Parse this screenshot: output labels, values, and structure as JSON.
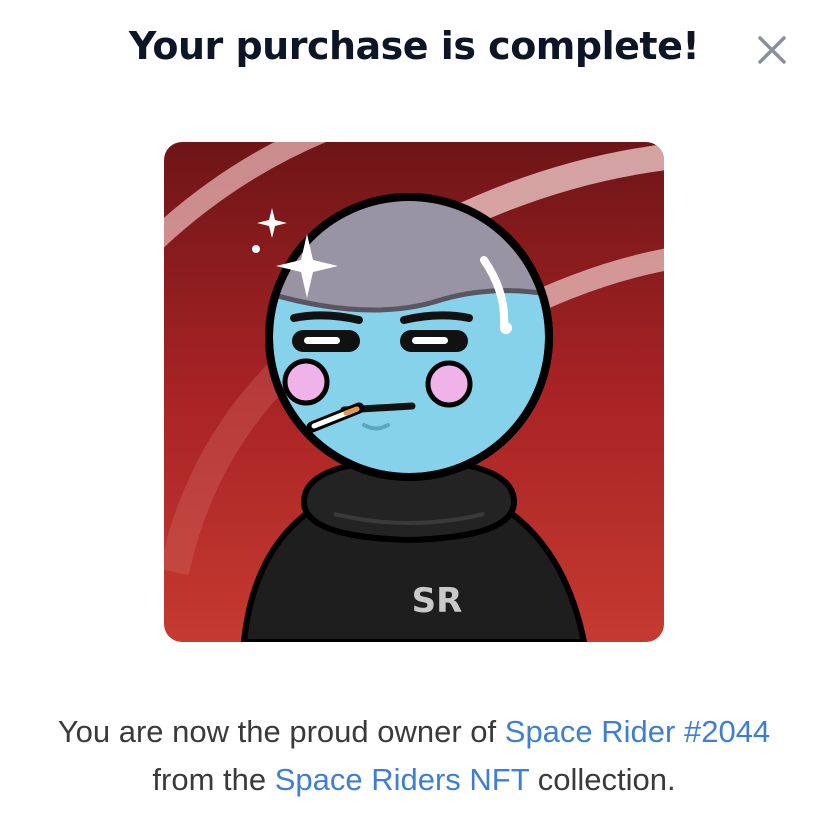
{
  "modal": {
    "title": "Your purchase is complete!",
    "close_icon": "close-icon"
  },
  "nft": {
    "image_icon": "space-rider-avatar",
    "shirt_text": "SR",
    "colors": {
      "background": "#b22a27",
      "helmet_face": "#86d2ea",
      "cheeks": "#f0b3e9",
      "hoodie": "#1e1e1e"
    }
  },
  "message": {
    "prefix": "You are now the proud owner of ",
    "item_link": "Space Rider #2044",
    "middle": " from the ",
    "collection_link": "Space Riders NFT",
    "suffix": " collection."
  },
  "colors": {
    "title": "#0d1526",
    "link": "#3f7fd1",
    "body_text": "#3a3a3a"
  }
}
